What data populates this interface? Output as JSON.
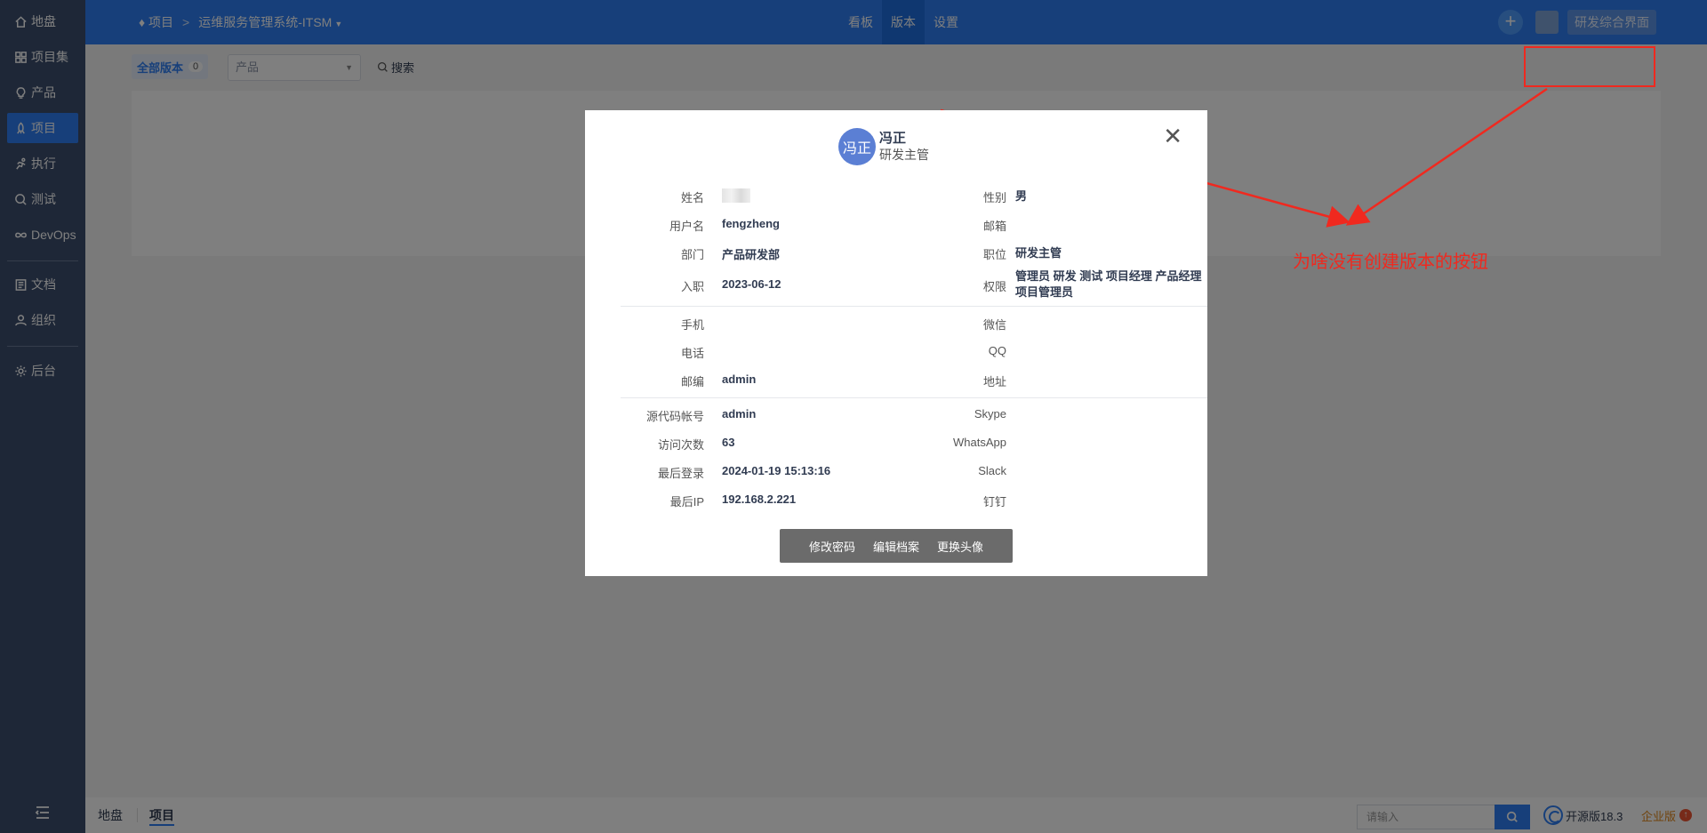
{
  "sidebar": {
    "items": [
      {
        "label": "地盘",
        "icon": "home-icon"
      },
      {
        "label": "项目集",
        "icon": "grid-icon"
      },
      {
        "label": "产品",
        "icon": "lightbulb-icon"
      },
      {
        "label": "项目",
        "icon": "rocket-icon"
      },
      {
        "label": "执行",
        "icon": "run-icon"
      },
      {
        "label": "测试",
        "icon": "search-icon"
      },
      {
        "label": "DevOps",
        "icon": "infinity-icon"
      },
      {
        "label": "文档",
        "icon": "document-icon"
      },
      {
        "label": "组织",
        "icon": "users-icon"
      },
      {
        "label": "后台",
        "icon": "gear-icon"
      }
    ],
    "active": "项目"
  },
  "header": {
    "breadcrumb_root": "项目",
    "breadcrumb_project": "运维服务管理系统-ITSM",
    "tabs": [
      "看板",
      "版本",
      "设置"
    ],
    "active_tab": "版本",
    "view_button": "研发综合界面"
  },
  "toolbar": {
    "all_versions_label": "全部版本",
    "all_versions_count": "0",
    "product_placeholder": "产品",
    "search_label": "搜索"
  },
  "modal": {
    "avatar_text": "冯正",
    "name": "冯正",
    "role": "研发主管",
    "rows": [
      {
        "label": "姓名",
        "value": "",
        "label2": "性别",
        "value2": "男"
      },
      {
        "label": "用户名",
        "value": "fengzheng",
        "label2": "邮箱",
        "value2": ""
      },
      {
        "label": "部门",
        "value": "产品研发部",
        "label2": "职位",
        "value2": "研发主管"
      },
      {
        "label": "入职",
        "value": "2023-06-12",
        "label2": "权限",
        "value2": "管理员 研发 测试 项目经理 产品经理 项目管理员"
      }
    ],
    "rows_contact": [
      {
        "label": "手机",
        "value": "",
        "label2": "微信",
        "value2": ""
      },
      {
        "label": "电话",
        "value": "",
        "label2": "QQ",
        "value2": ""
      },
      {
        "label": "邮编",
        "value": "admin",
        "label2": "地址",
        "value2": ""
      }
    ],
    "rows_account": [
      {
        "label": "源代码帐号",
        "value": "admin",
        "label2": "Skype",
        "value2": ""
      },
      {
        "label": "访问次数",
        "value": "63",
        "label2": "WhatsApp",
        "value2": ""
      },
      {
        "label": "最后登录",
        "value": "2024-01-19 15:13:16",
        "label2": "Slack",
        "value2": ""
      },
      {
        "label": "最后IP",
        "value": "192.168.2.221",
        "label2": "钉钉",
        "value2": ""
      }
    ],
    "actions": [
      "修改密码",
      "编辑档案",
      "更换头像"
    ]
  },
  "annotation": {
    "text": "为啥没有创建版本的按钮",
    "color": "#f0291f"
  },
  "bottombar": {
    "links": [
      "地盘",
      "项目"
    ],
    "active": "项目",
    "search_placeholder": "请输入",
    "edition": "开源版18.3",
    "enterprise": "企业版"
  },
  "colors": {
    "primary": "#2e7ff5",
    "sidebar": "#3d4f6e"
  }
}
